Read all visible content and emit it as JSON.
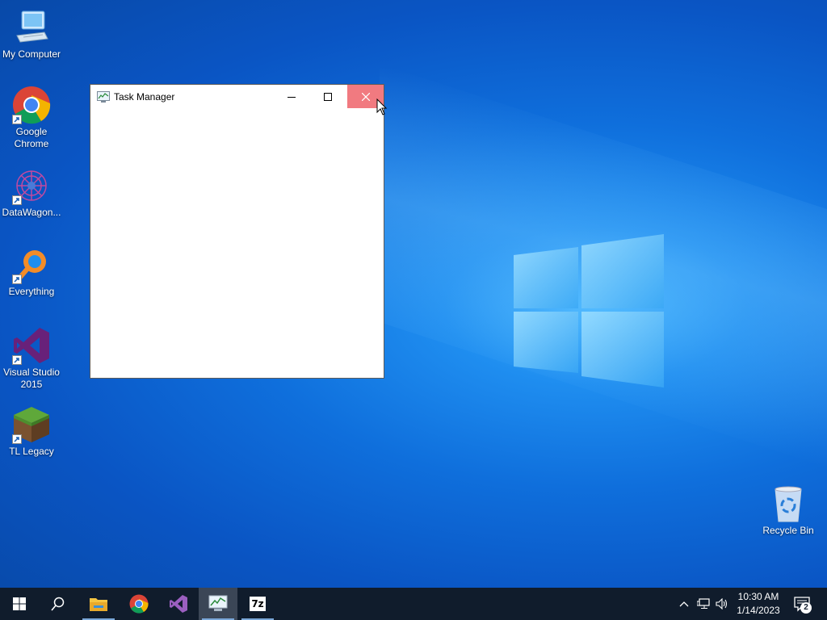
{
  "desktop": {
    "icons": [
      {
        "label": "My Computer",
        "icon": "computer-icon"
      },
      {
        "label": "Google\nChrome",
        "icon": "chrome-icon"
      },
      {
        "label": "DataWagon...",
        "icon": "datawagon-icon"
      },
      {
        "label": "Everything",
        "icon": "everything-search-icon"
      },
      {
        "label": "Visual Studio\n2015",
        "icon": "visual-studio-icon"
      },
      {
        "label": "TL Legacy",
        "icon": "minecraft-grass-block-icon"
      }
    ],
    "recycle_bin": {
      "label": "Recycle Bin",
      "icon": "recycle-bin-icon"
    }
  },
  "window": {
    "title": "Task Manager",
    "icon": "task-manager-icon",
    "controls": {
      "minimize": "minimize-icon",
      "maximize": "maximize-icon",
      "close": "close-icon"
    },
    "close_hover_color": "#f17a80"
  },
  "taskbar": {
    "start": "windows-start-icon",
    "search": "search-icon",
    "pinned": [
      {
        "name": "file-explorer",
        "icon": "folder-icon"
      },
      {
        "name": "chrome",
        "icon": "chrome-icon"
      },
      {
        "name": "visual-studio",
        "icon": "visual-studio-icon"
      },
      {
        "name": "task-manager",
        "icon": "task-manager-icon",
        "active": true
      },
      {
        "name": "7zip",
        "icon": "7zip-icon",
        "text": "7z"
      }
    ],
    "tray": {
      "icons": [
        "chevron-up-icon",
        "network-icon",
        "volume-icon"
      ],
      "time": "10:30 AM",
      "date": "1/14/2023",
      "notification_count": "2"
    },
    "background": "#101c2c"
  }
}
